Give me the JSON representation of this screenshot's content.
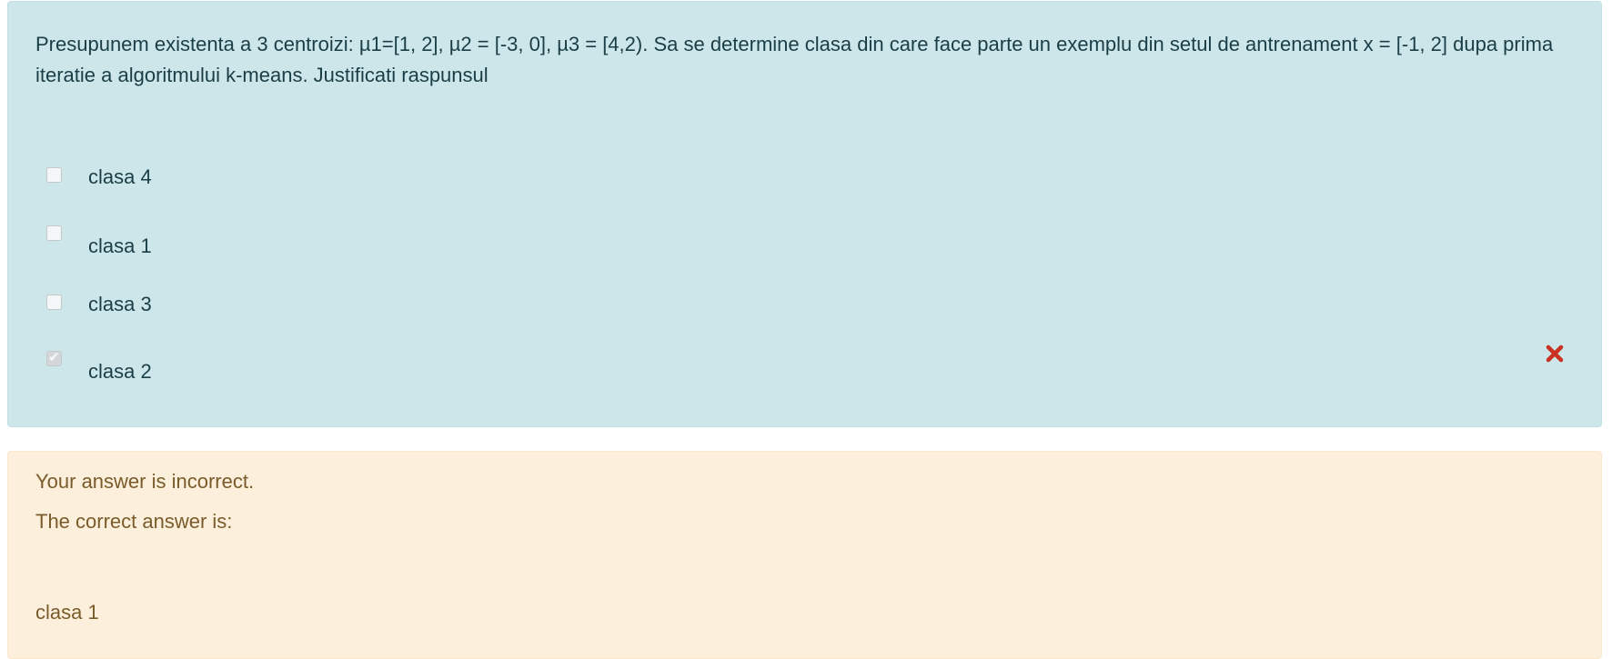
{
  "question": {
    "text": "Presupunem existenta a 3 centroizi: µ1=[1, 2], µ2 = [-3, 0], µ3 = [4,2). Sa se determine clasa din care face parte un exemplu din setul de antrenament x = [-1, 2] dupa prima iteratie a algoritmului k-means. Justificati raspunsul",
    "options": [
      {
        "label": "clasa 4",
        "checked": false
      },
      {
        "label": "clasa 1",
        "checked": false
      },
      {
        "label": "clasa 3",
        "checked": false
      },
      {
        "label": "clasa 2",
        "checked": true
      }
    ],
    "result_icon": "cross-icon",
    "result_icon_color": "#ca3120"
  },
  "feedback": {
    "status": "Your answer is incorrect.",
    "correct_prefix": "The correct answer is:",
    "correct_answer": "clasa 1"
  },
  "colors": {
    "question_bg": "#cce6ea",
    "feedback_bg": "#fcefdc",
    "question_text": "#1b3e46",
    "feedback_text": "#7a5b2a"
  }
}
